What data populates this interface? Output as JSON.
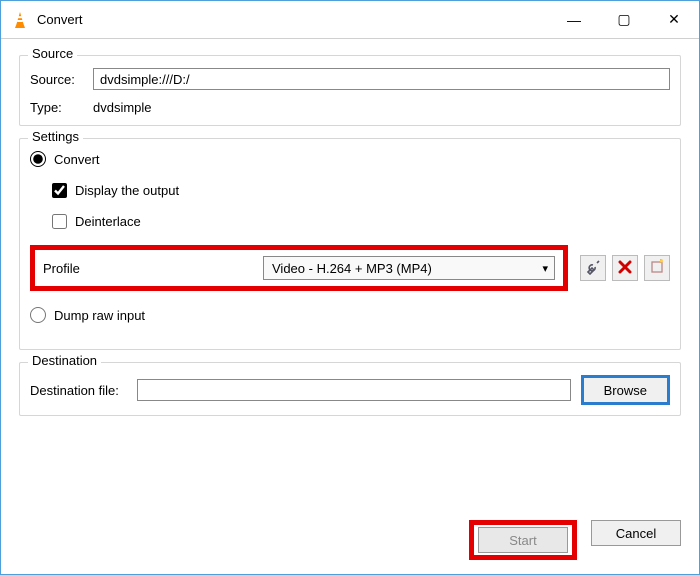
{
  "window": {
    "title": "Convert"
  },
  "titlebar": {
    "min": "—",
    "max": "▢",
    "close": "✕"
  },
  "source": {
    "legend": "Source",
    "sourceLabel": "Source:",
    "sourceValue": "dvdsimple:///D:/",
    "typeLabel": "Type:",
    "typeValue": "dvdsimple"
  },
  "settings": {
    "legend": "Settings",
    "convertLabel": "Convert",
    "displayOutput": "Display the output",
    "deinterlace": "Deinterlace",
    "profileLabel": "Profile",
    "profileValue": "Video - H.264 + MP3 (MP4)",
    "dumpRaw": "Dump raw input"
  },
  "destination": {
    "legend": "Destination",
    "fileLabel": "Destination file:",
    "fileValue": "",
    "browse": "Browse"
  },
  "actions": {
    "start": "Start",
    "cancel": "Cancel"
  }
}
